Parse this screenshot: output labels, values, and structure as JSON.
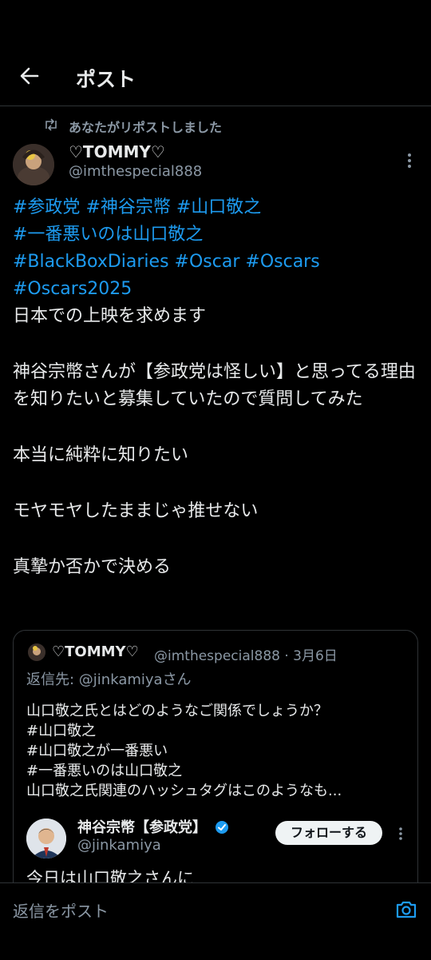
{
  "header": {
    "title": "ポスト"
  },
  "repost": {
    "text": "あなたがリポストしました"
  },
  "post": {
    "display_name": "♡TOMMY♡",
    "handle": "@imthespecial888",
    "hashtag_lines": [
      [
        "#参政党",
        "#神谷宗幣",
        "#山口敬之"
      ],
      [
        "#一番悪いのは山口敬之"
      ],
      [
        "#BlackBoxDiaries",
        "#Oscar",
        "#Oscars"
      ],
      [
        "#Oscars2025"
      ]
    ],
    "lines": {
      "l1": "日本での上映を求めます",
      "l2": "神谷宗幣さんが【参政党は怪しい】と思ってる理由を知りたいと募集していたので質問してみた",
      "l3": "本当に純粋に知りたい",
      "l4": "モヤモヤしたままじゃ推せない",
      "l5": "真摯か否かで決める"
    }
  },
  "quote": {
    "display_name": "♡TOMMY♡",
    "meta": "@imthespecial888 · 3月6日",
    "reply_prefix": "返信先: ",
    "reply_mention": "@jinkamiyaさん",
    "text_lines": [
      "山口敬之氏とはどのようなご関係でしょうか？",
      "#山口敬之",
      "#山口敬之が一番悪い",
      "#一番悪いのは山口敬之",
      "山口敬之氏関連のハッシュタグはこのようなも..."
    ],
    "embed": {
      "name": "神谷宗幣【参政党】",
      "handle": "@jinkamiya",
      "follow_label": "フォローする",
      "text": "今日は山口敬之さんに"
    }
  },
  "reply_bar": {
    "placeholder": "返信をポスト"
  },
  "colors": {
    "accent": "#1d9bf0",
    "muted": "#8b98a5",
    "text": "#e7e9ea",
    "background": "#000000"
  },
  "icons": {
    "back": "back-arrow-icon",
    "repost": "repost-icon",
    "more": "more-vertical-icon",
    "verified": "verified-badge-icon",
    "camera": "camera-icon"
  }
}
